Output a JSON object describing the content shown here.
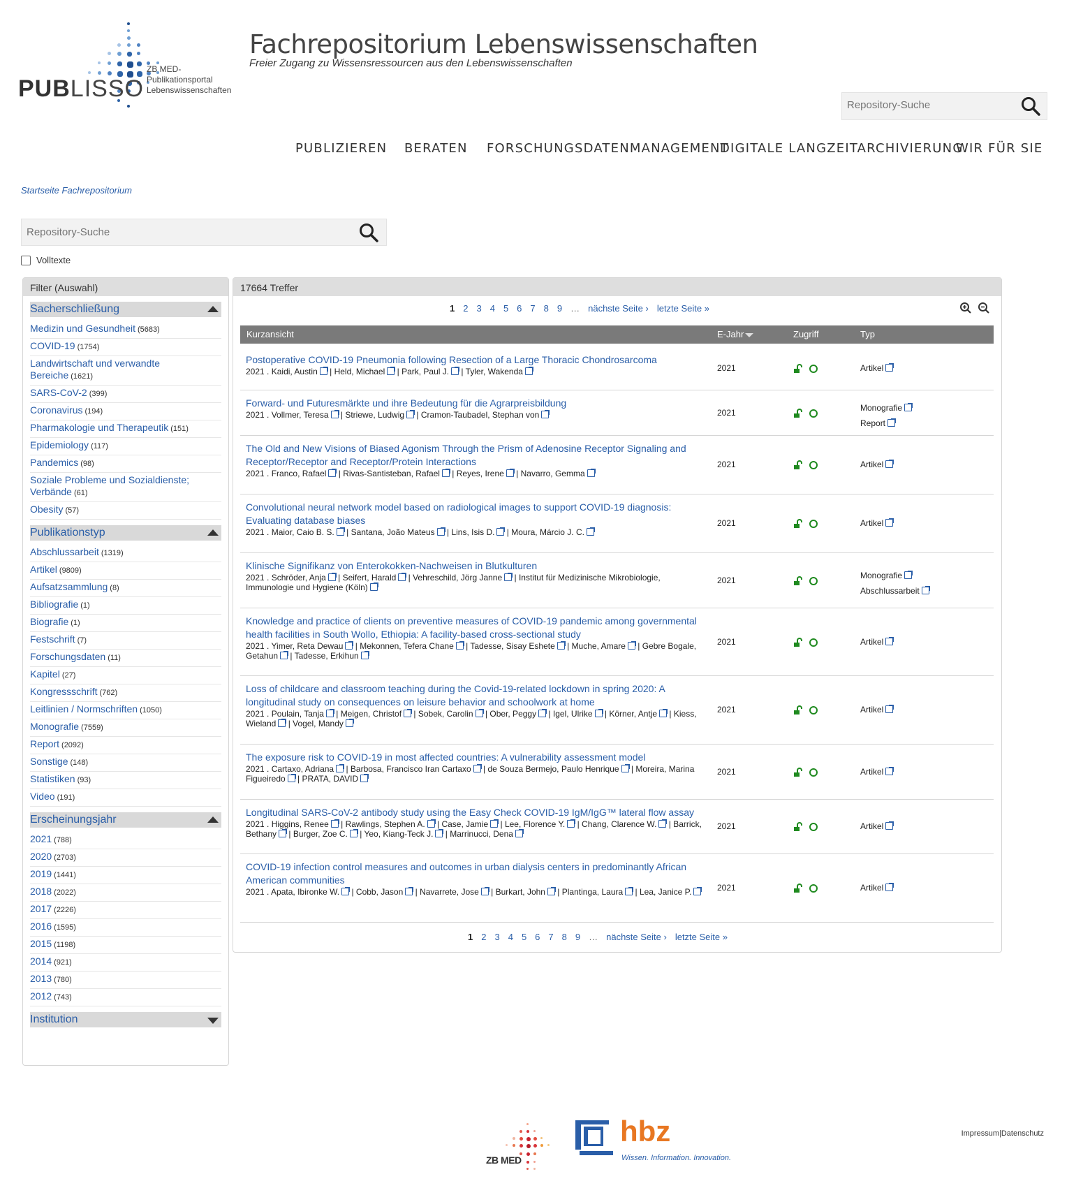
{
  "header": {
    "logo_brand": "PUBLISSO",
    "logo_brand_part1": "PUB",
    "logo_brand_part2": "LISSO",
    "logo_tagline_line1": "ZB MED-Publikationsportal",
    "logo_tagline_line2": "Lebenswissenschaften",
    "site_title": "Fachrepositorium Lebenswissenschaften",
    "site_subtitle": "Freier Zugang zu Wissensressourcen aus den Lebenswissenschaften",
    "search_placeholder": "Repository-Suche"
  },
  "nav": [
    "PUBLIZIEREN",
    "BERATEN",
    "FORSCHUNGSDATENMANAGEMENT",
    "DIGITALE LANGZEITARCHIVIERUNG",
    "WIR FÜR SIE"
  ],
  "breadcrumb": "Startseite Fachrepositorium",
  "main_search": {
    "placeholder": "Repository-Suche"
  },
  "fulltext_label": "Volltexte",
  "sidebar": {
    "header": "Filter (Auswahl)",
    "facets": [
      {
        "title": "Sacherschließung",
        "expanded": true,
        "items": [
          {
            "label": "Medizin und Gesundheit",
            "count": "(5683)"
          },
          {
            "label": "COVID-19",
            "count": "(1754)"
          },
          {
            "label": "Landwirtschaft und verwandte Bereiche",
            "count": "(1621)"
          },
          {
            "label": "SARS-CoV-2",
            "count": "(399)"
          },
          {
            "label": "Coronavirus",
            "count": "(194)"
          },
          {
            "label": "Pharmakologie und Therapeutik",
            "count": "(151)"
          },
          {
            "label": "Epidemiology",
            "count": "(117)"
          },
          {
            "label": "Pandemics",
            "count": "(98)"
          },
          {
            "label": "Soziale Probleme und Sozialdienste; Verbände",
            "count": "(61)"
          },
          {
            "label": "Obesity",
            "count": "(57)"
          }
        ]
      },
      {
        "title": "Publikationstyp",
        "expanded": true,
        "items": [
          {
            "label": "Abschlussarbeit",
            "count": "(1319)"
          },
          {
            "label": "Artikel",
            "count": "(9809)"
          },
          {
            "label": "Aufsatzsammlung",
            "count": "(8)"
          },
          {
            "label": "Bibliografie",
            "count": "(1)"
          },
          {
            "label": "Biografie",
            "count": "(1)"
          },
          {
            "label": "Festschrift",
            "count": "(7)"
          },
          {
            "label": "Forschungsdaten",
            "count": "(11)"
          },
          {
            "label": "Kapitel",
            "count": "(27)"
          },
          {
            "label": "Kongressschrift",
            "count": "(762)"
          },
          {
            "label": "Leitlinien / Normschriften",
            "count": "(1050)"
          },
          {
            "label": "Monografie",
            "count": "(7559)"
          },
          {
            "label": "Report",
            "count": "(2092)"
          },
          {
            "label": "Sonstige",
            "count": "(148)"
          },
          {
            "label": "Statistiken",
            "count": "(93)"
          },
          {
            "label": "Video",
            "count": "(191)"
          }
        ]
      },
      {
        "title": "Erscheinungsjahr",
        "expanded": true,
        "items": [
          {
            "label": "2021",
            "count": "(788)"
          },
          {
            "label": "2020",
            "count": "(2703)"
          },
          {
            "label": "2019",
            "count": "(1441)"
          },
          {
            "label": "2018",
            "count": "(2022)"
          },
          {
            "label": "2017",
            "count": "(2226)"
          },
          {
            "label": "2016",
            "count": "(1595)"
          },
          {
            "label": "2015",
            "count": "(1198)"
          },
          {
            "label": "2014",
            "count": "(921)"
          },
          {
            "label": "2013",
            "count": "(780)"
          },
          {
            "label": "2012",
            "count": "(743)"
          }
        ]
      },
      {
        "title": "Institution",
        "expanded": false,
        "items": []
      }
    ]
  },
  "results": {
    "header": "17664 Treffer",
    "pager": {
      "pages": [
        "1",
        "2",
        "3",
        "4",
        "5",
        "6",
        "7",
        "8",
        "9"
      ],
      "current": "1",
      "ellipsis": "…",
      "next": "nächste Seite ›",
      "last": "letzte Seite »"
    },
    "columns": [
      "Kurzansicht",
      "E-Jahr",
      "Zugriff",
      "Typ"
    ],
    "rows": [
      {
        "title": "Postoperative COVID-19 Pneumonia following Resection of a Large Thoracic Chondrosarcoma",
        "year_prefix": "2021",
        "authors": [
          "Kaidi, Austin",
          "Held, Michael",
          "Park, Paul J.",
          "Tyler, Wakenda"
        ],
        "year": "2021",
        "types": [
          "Artikel"
        ]
      },
      {
        "title": "Forward- und Futuresmärkte und ihre Bedeutung für die Agrarpreisbildung",
        "year_prefix": "2021",
        "authors": [
          "Vollmer, Teresa",
          "Striewe, Ludwig",
          "Cramon-Taubadel, Stephan von"
        ],
        "year": "2021",
        "types": [
          "Monografie",
          "Report"
        ]
      },
      {
        "title": "The Old and New Visions of Biased Agonism Through the Prism of Adenosine Receptor Signaling and Receptor/Receptor and Receptor/Protein Interactions",
        "year_prefix": "2021",
        "authors": [
          "Franco, Rafael",
          "Rivas-Santisteban, Rafael",
          "Reyes, Irene",
          "Navarro, Gemma"
        ],
        "year": "2021",
        "types": [
          "Artikel"
        ]
      },
      {
        "title": "Convolutional neural network model based on radiological images to support COVID-19 diagnosis: Evaluating database biases",
        "year_prefix": "2021",
        "authors": [
          "Maior, Caio B. S.",
          "Santana, João Mateus",
          "Lins, Isis D.",
          "Moura, Márcio J. C."
        ],
        "year": "2021",
        "types": [
          "Artikel"
        ]
      },
      {
        "title": "Klinische Signifikanz von Enterokokken-Nachweisen in Blutkulturen",
        "year_prefix": "2021",
        "authors": [
          "Schröder, Anja",
          "Seifert, Harald",
          "Vehreschild, Jörg Janne",
          "Institut für Medizinische Mikrobiologie, Immunologie und Hygiene (Köln)"
        ],
        "year": "2021",
        "types": [
          "Monografie",
          "Abschlussarbeit"
        ]
      },
      {
        "title": "Knowledge and practice of clients on preventive measures of COVID-19 pandemic among governmental health facilities in South Wollo, Ethiopia: A facility-based cross-sectional study",
        "year_prefix": "2021",
        "authors": [
          "Yimer, Reta Dewau",
          "Mekonnen, Tefera Chane",
          "Tadesse, Sisay Eshete",
          "Muche, Amare",
          "Gebre Bogale, Getahun",
          "Tadesse, Erkihun"
        ],
        "year": "2021",
        "types": [
          "Artikel"
        ]
      },
      {
        "title": "Loss of childcare and classroom teaching during the Covid-19-related lockdown in spring 2020: A longitudinal study on consequences on leisure behavior and schoolwork at home",
        "year_prefix": "2021",
        "authors": [
          "Poulain, Tanja",
          "Meigen, Christof",
          "Sobek, Carolin",
          "Ober, Peggy",
          "Igel, Ulrike",
          "Körner, Antje",
          "Kiess, Wieland",
          "Vogel, Mandy"
        ],
        "year": "2021",
        "types": [
          "Artikel"
        ]
      },
      {
        "title": "The exposure risk to COVID-19 in most affected countries: A vulnerability assessment model",
        "year_prefix": "2021",
        "authors": [
          "Cartaxo, Adriana",
          "Barbosa, Francisco Iran Cartaxo",
          "de Souza Bermejo, Paulo Henrique",
          "Moreira, Marina Figueiredo",
          "PRATA, DAVID"
        ],
        "year": "2021",
        "types": [
          "Artikel"
        ]
      },
      {
        "title": "Longitudinal SARS-CoV-2 antibody study using the Easy Check COVID-19 IgM/IgG™ lateral flow assay",
        "year_prefix": "2021",
        "authors": [
          "Higgins, Renee",
          "Rawlings, Stephen A.",
          "Case, Jamie",
          "Lee, Florence Y.",
          "Chang, Clarence W.",
          "Barrick, Bethany",
          "Burger, Zoe C.",
          "Yeo, Kiang-Teck J.",
          "Marrinucci, Dena"
        ],
        "year": "2021",
        "types": [
          "Artikel"
        ]
      },
      {
        "title": "COVID-19 infection control measures and outcomes in urban dialysis centers in predominantly African American communities",
        "year_prefix": "2021",
        "authors": [
          "Apata, Ibironke W.",
          "Cobb, Jason",
          "Navarrete, Jose",
          "Burkart, John",
          "Plantinga, Laura",
          "Lea, Janice P."
        ],
        "year": "2021",
        "types": [
          "Artikel"
        ]
      }
    ]
  },
  "footer": {
    "zbmed_logo_text": "ZB MED",
    "hbz_logo_text": "hbz",
    "hbz_tagline": "Wissen. Information. Innovation.",
    "links": [
      "Impressum",
      "Datenschutz"
    ],
    "separator": "|"
  },
  "colors": {
    "link": "#2a5ea8",
    "table_header_bg": "#7a7a7a",
    "facet_header_bg": "#d9d9d9",
    "access_green": "#1f8a1f",
    "hbz_orange": "#e87722",
    "hbz_blue": "#2a5ea8"
  }
}
